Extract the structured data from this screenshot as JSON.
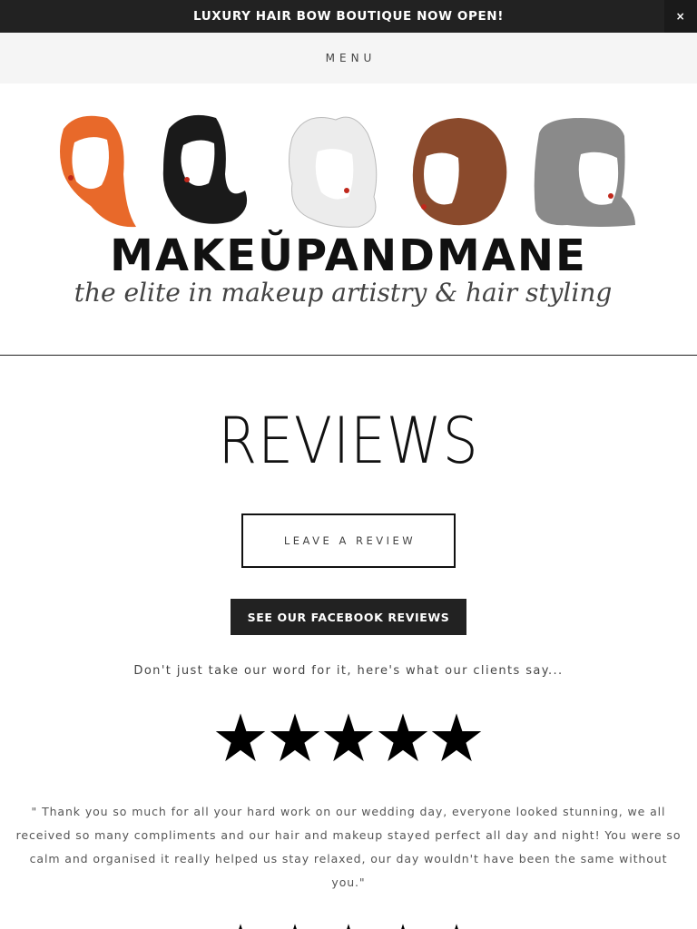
{
  "announcement": {
    "text": "LUXURY HAIR BOW BOUTIQUE NOW OPEN!",
    "close_label": "×"
  },
  "nav": {
    "menu_label": "MENU"
  },
  "logo": {
    "brand": "MAKEŬPANDMANE",
    "tagline": "the elite in makeup artistry & hair styling",
    "hair_colors": [
      "#e8692a",
      "#1a1a1a",
      "#ececec",
      "#8a4a2c",
      "#8a8a8a"
    ]
  },
  "page": {
    "title": "REVIEWS"
  },
  "buttons": {
    "leave_review": "LEAVE A REVIEW",
    "facebook_reviews": "SEE OUR FACEBOOK REVIEWS"
  },
  "intro_text": "Don't just take our word for it, here's what our clients say...",
  "reviews": [
    {
      "rating": 5,
      "text": "\" Thank you so much for all your hard work on our wedding day, everyone looked stunning, we all received so many compliments and our hair and makeup stayed perfect all day and night! You were so calm and organised it really helped us stay relaxed, our day wouldn't have been the same without you.\""
    }
  ],
  "colors": {
    "dark": "#222222",
    "menu_bg": "#f5f5f5",
    "text_muted": "#555555"
  }
}
